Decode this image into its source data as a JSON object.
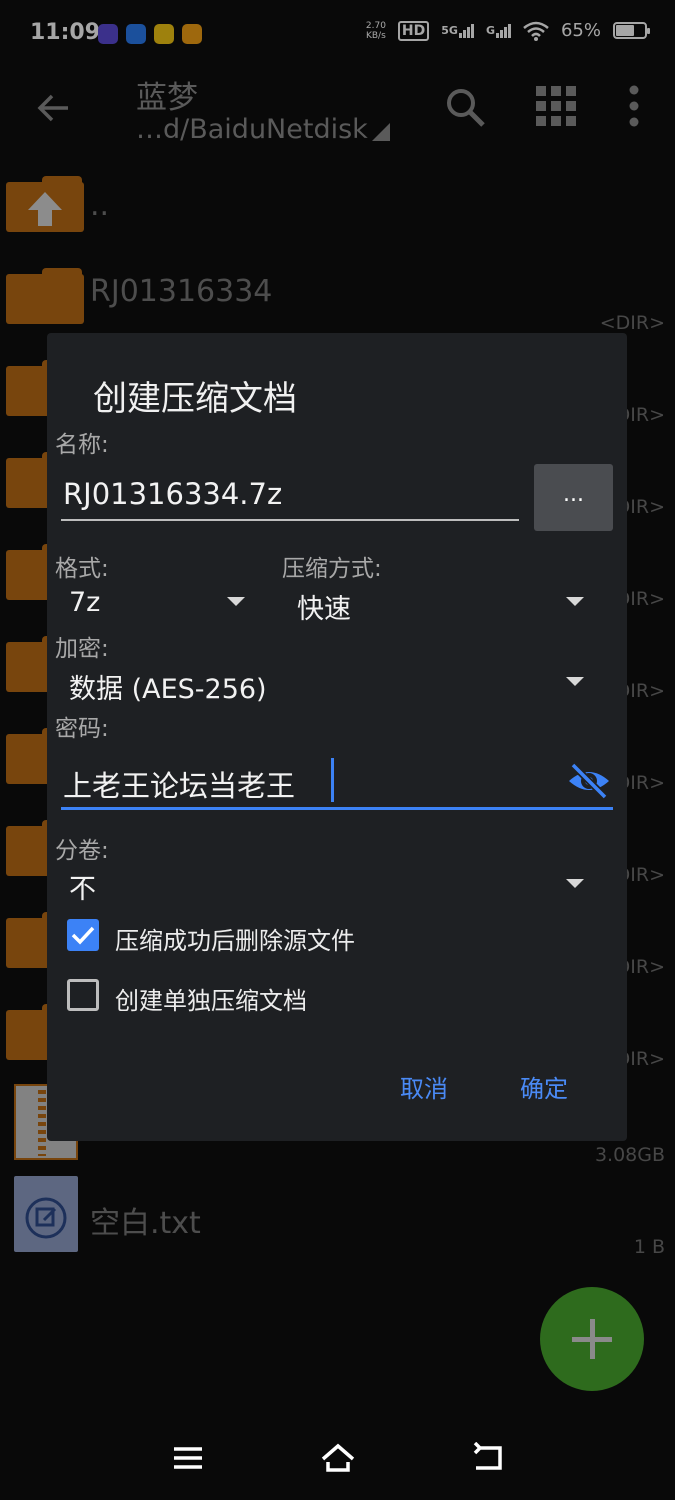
{
  "status_bar": {
    "time": "11:09",
    "net_speed_value": "2.70",
    "net_speed_unit": "KB/s",
    "hd_label": "HD",
    "signal_5g": "5G",
    "signal_g": "G",
    "battery_percent": "65%",
    "battery_level": 0.65
  },
  "toolbar": {
    "title": "蓝梦",
    "path": "…d/BaiduNetdisk"
  },
  "files": [
    {
      "name": "..",
      "meta": ""
    },
    {
      "name": "RJ01316334",
      "meta": "<DIR>"
    },
    {
      "name": "",
      "meta": "DIR>"
    },
    {
      "name": "",
      "meta": "DIR>"
    },
    {
      "name": "",
      "meta": "DIR>"
    },
    {
      "name": "",
      "meta": "DIR>"
    },
    {
      "name": "",
      "meta": "DIR>"
    },
    {
      "name": "",
      "meta": "DIR>"
    },
    {
      "name": "",
      "meta": "DIR>"
    },
    {
      "name": "",
      "meta": "DIR>"
    },
    {
      "name": "",
      "meta": "3.08GB"
    },
    {
      "name": "空白.txt",
      "meta": "1 B"
    }
  ],
  "dialog": {
    "title": "创建压缩文档",
    "name_label": "名称:",
    "name_value": "RJ01316334.7z",
    "browse_label": "...",
    "format_label": "格式:",
    "format_value": "7z",
    "method_label": "压缩方式:",
    "method_value": "快速",
    "encryption_label": "加密:",
    "encryption_value": "数据 (AES-256)",
    "password_label": "密码:",
    "password_value": "上老王论坛当老王",
    "split_label": "分卷:",
    "split_value": "不",
    "delete_source_label": "压缩成功后删除源文件",
    "delete_source_checked": true,
    "separate_archive_label": "创建单独压缩文档",
    "separate_archive_checked": false,
    "cancel_label": "取消",
    "ok_label": "确定"
  },
  "colors": {
    "accent": "#3c82f6",
    "folder": "#b86a15",
    "fab": "#2e6b1d",
    "dialog_bg": "#1e2023"
  }
}
